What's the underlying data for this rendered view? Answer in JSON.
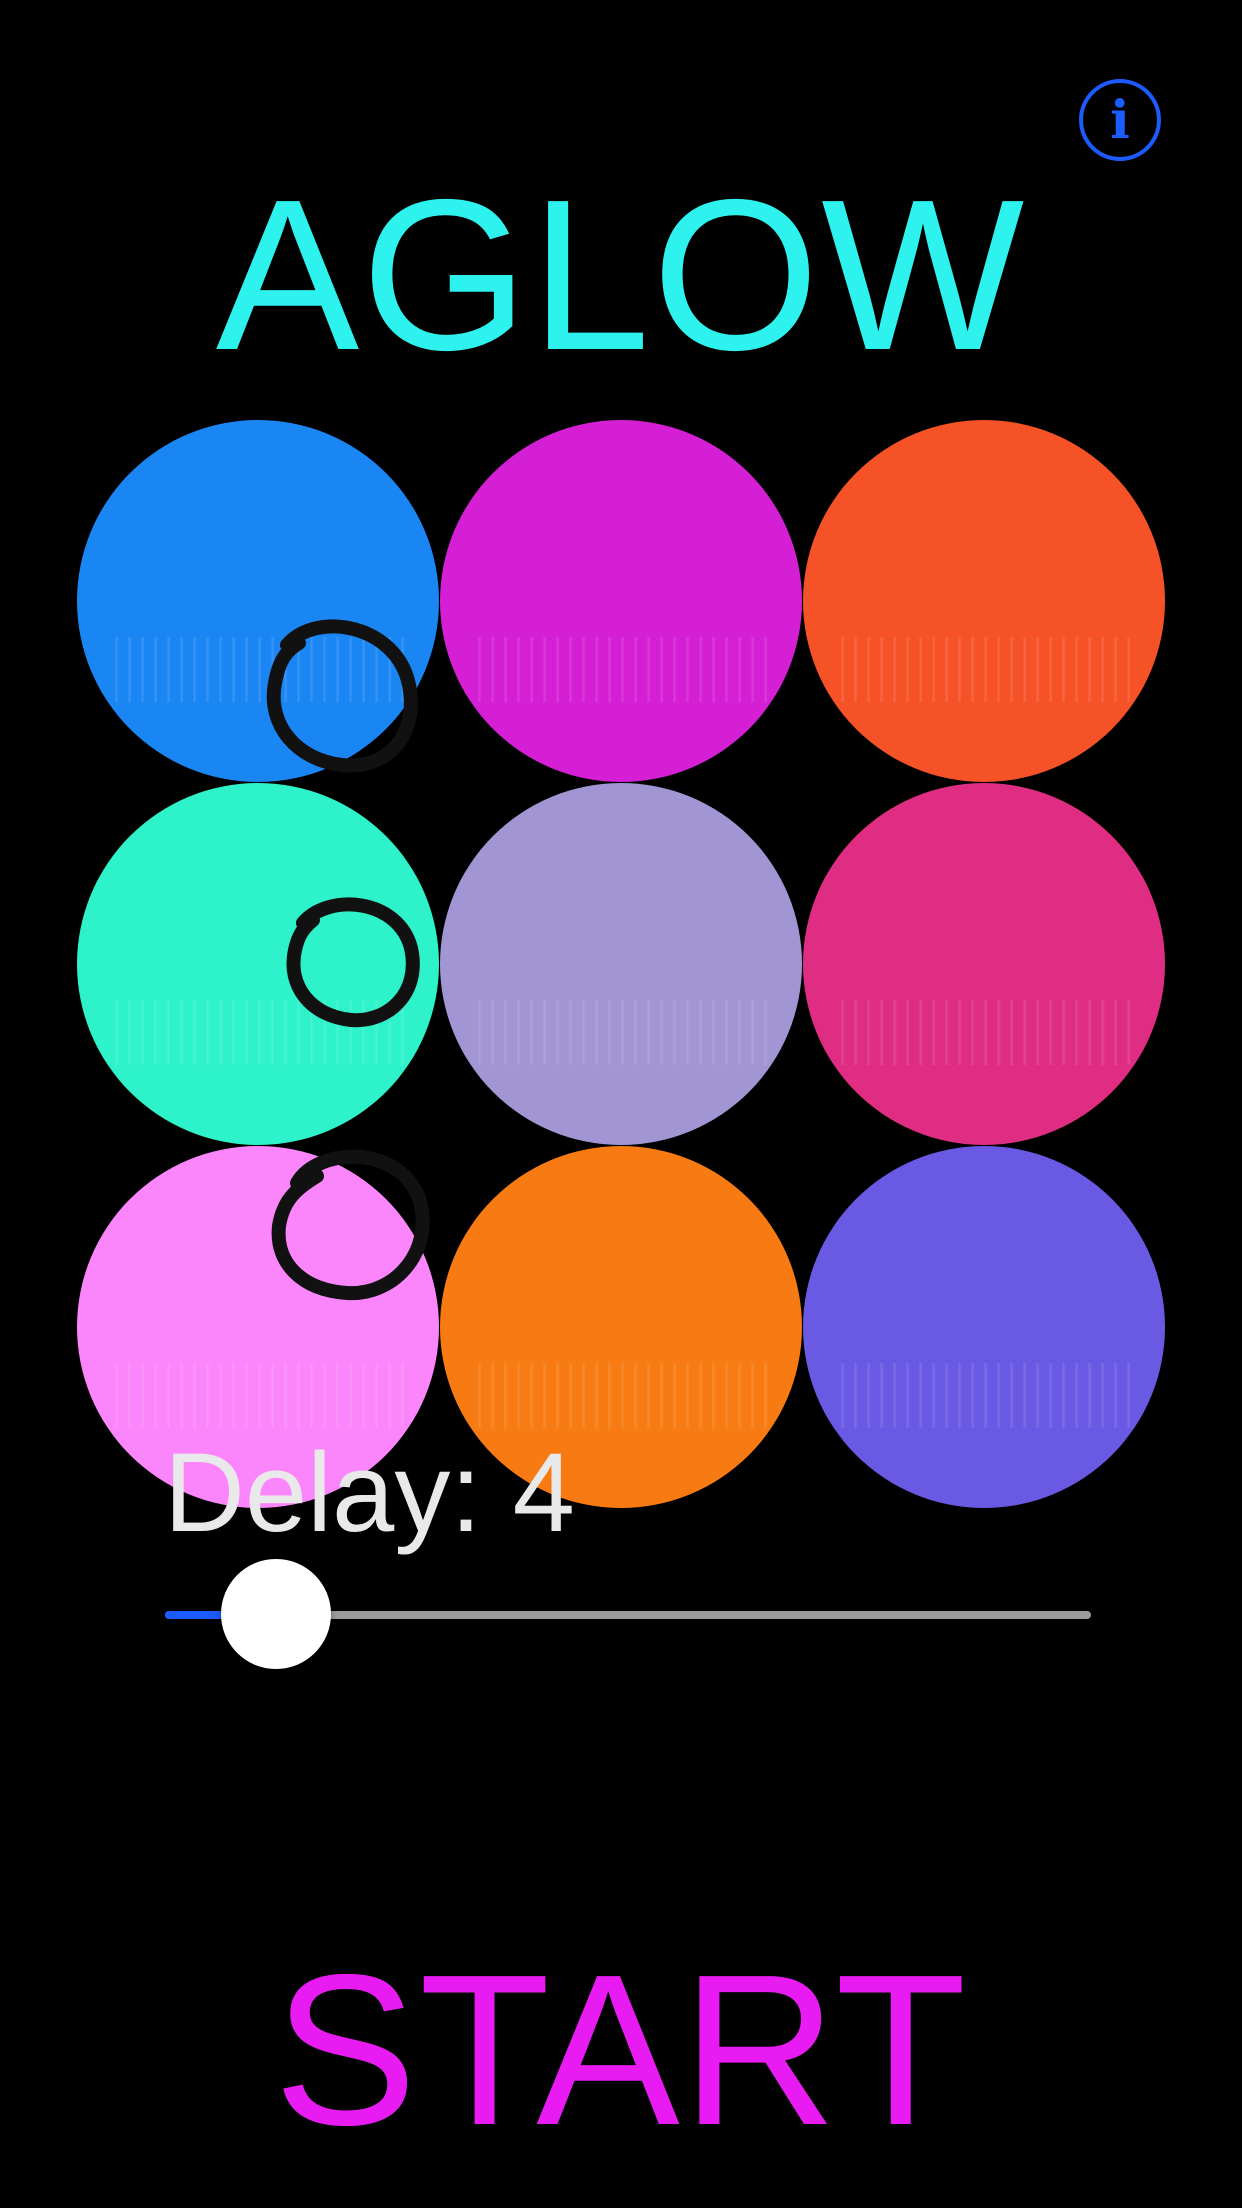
{
  "header": {
    "info_icon": "info-icon",
    "info_glyph": "i",
    "title": "AGLOW"
  },
  "grid": {
    "bubbles": [
      {
        "color": "#1a86f4"
      },
      {
        "color": "#d41fd4"
      },
      {
        "color": "#f55228"
      },
      {
        "color": "#2ef2c9"
      },
      {
        "color": "#a295d3"
      },
      {
        "color": "#df2d84"
      },
      {
        "color": "#fb86fb"
      },
      {
        "color": "#f77b12"
      },
      {
        "color": "#6a59e3"
      }
    ]
  },
  "delay": {
    "label": "Delay: 4",
    "value_fraction": 0.12
  },
  "start": {
    "label": "START"
  },
  "colors": {
    "background": "#000000",
    "title": "#2ef2ee",
    "info": "#1a5cff",
    "slider_fill": "#1a5cff",
    "slider_track": "#9b9b9b",
    "start": "#e81cf2"
  }
}
